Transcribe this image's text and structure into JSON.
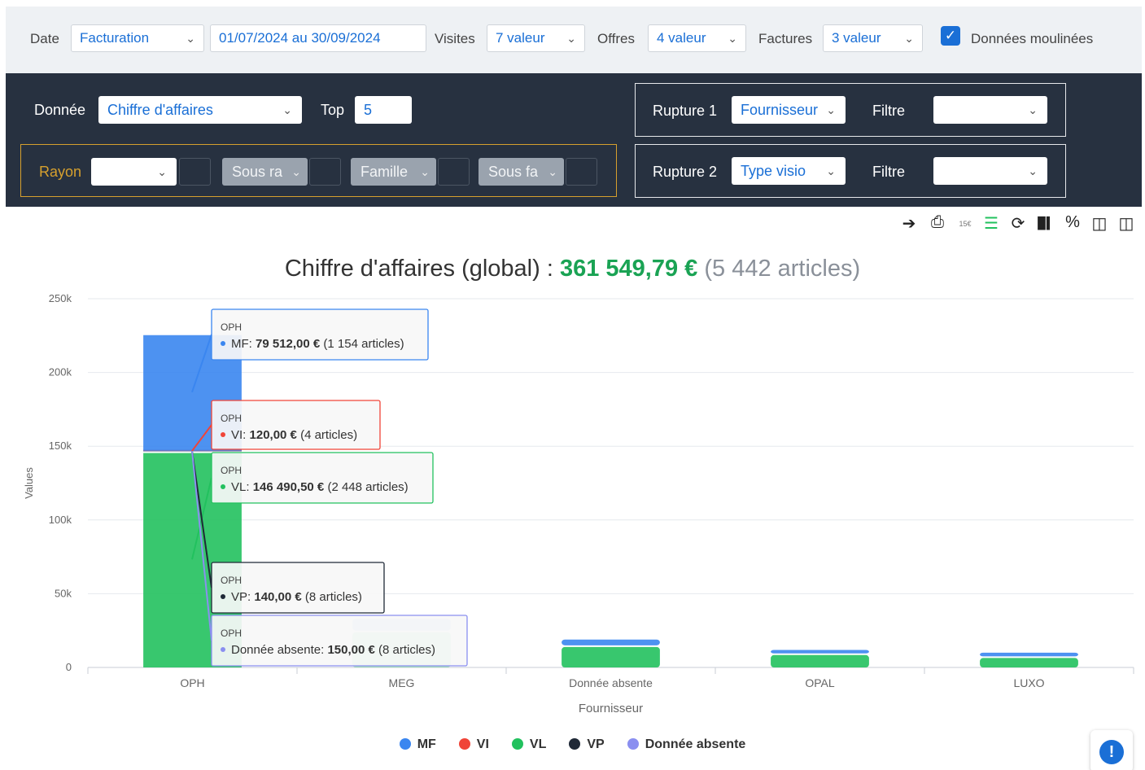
{
  "filters": {
    "date_label": "Date",
    "date_type": "Facturation",
    "date_range": "01/07/2024 au 30/09/2024",
    "visites_label": "Visites",
    "visites_value": "7 valeur",
    "offres_label": "Offres",
    "offres_value": "4 valeur",
    "factures_label": "Factures",
    "factures_value": "3 valeur",
    "moulinees_label": "Données moulinées",
    "moulinees_checked": true
  },
  "panel": {
    "donnee_label": "Donnée",
    "donnee_value": "Chiffre d'affaires",
    "top_label": "Top",
    "top_value": "5",
    "rayon_label": "Rayon",
    "rayon_value": "",
    "sous_rayon_value": "Sous ra",
    "famille_value": "Famille",
    "sous_famille_value": "Sous fa",
    "rupture1_label": "Rupture 1",
    "rupture1_value": "Fournisseur",
    "rupture2_label": "Rupture 2",
    "rupture2_value": "Type visio",
    "filtre_label": "Filtre",
    "filtre1_value": "",
    "filtre2_value": ""
  },
  "toolbar": {
    "icons": [
      "export-icon",
      "print-icon",
      "price-icon",
      "stack-icon",
      "refresh-icon",
      "bar-chart-icon",
      "percent-icon",
      "columns-icon",
      "save-icon"
    ],
    "price_text": "15€"
  },
  "header": {
    "title_prefix": "Chiffre d'affaires (global) : ",
    "title_value": "361 549,79 €",
    "title_count": "(5 442 articles)"
  },
  "colors": {
    "MF": "#3a86f0",
    "VI": "#f04438",
    "VL": "#22c15e",
    "VP": "#1f2937",
    "Donnée absente": "#8a8ff0"
  },
  "chart_data": {
    "type": "bar",
    "stacked": true,
    "xlabel": "Fournisseur",
    "ylabel": "Values",
    "ylim": [
      0,
      250000
    ],
    "yticks": [
      "0",
      "50k",
      "100k",
      "150k",
      "200k",
      "250k"
    ],
    "grid": true,
    "legend_position": "bottom",
    "categories": [
      "OPH",
      "MEG",
      "Donnée absente",
      "OPAL",
      "LUXO"
    ],
    "series": [
      {
        "name": "VL",
        "values": [
          146490.5,
          25000,
          15000,
          9500,
          7500
        ]
      },
      {
        "name": "VP",
        "values": [
          140,
          0,
          0,
          0,
          0
        ]
      },
      {
        "name": "Donnée absente",
        "values": [
          150,
          0,
          0,
          0,
          0
        ]
      },
      {
        "name": "VI",
        "values": [
          120,
          0,
          0,
          0,
          0
        ]
      },
      {
        "name": "MF",
        "values": [
          79512,
          9000,
          5000,
          3500,
          2500
        ]
      }
    ],
    "tooltips": [
      {
        "category": "OPH",
        "series": "MF",
        "name": "MF",
        "value": "79 512,00 €",
        "count": "(1 154 articles)"
      },
      {
        "category": "OPH",
        "series": "VI",
        "name": "VI",
        "value": "120,00 €",
        "count": "(4 articles)"
      },
      {
        "category": "OPH",
        "series": "VL",
        "name": "VL",
        "value": "146 490,50 €",
        "count": "(2 448 articles)"
      },
      {
        "category": "OPH",
        "series": "VP",
        "name": "VP",
        "value": "140,00 €",
        "count": "(8 articles)"
      },
      {
        "category": "OPH",
        "series": "Donnée absente",
        "name": "Donnée absente",
        "value": "150,00 €",
        "count": "(8 articles)"
      }
    ]
  },
  "legend": [
    "MF",
    "VI",
    "VL",
    "VP",
    "Donnée absente"
  ],
  "help_label": "!"
}
